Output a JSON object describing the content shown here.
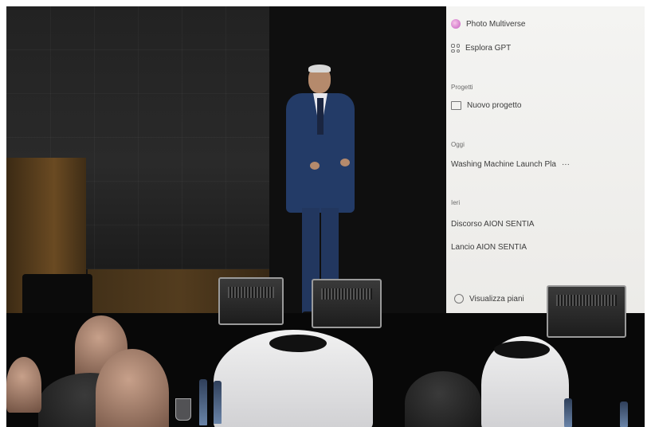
{
  "screen_menu": {
    "photo_label": "Photo Multiverse",
    "explore_label": "Esplora GPT",
    "projects_heading": "Progetti",
    "new_project_label": "Nuovo progetto",
    "today_heading": "Oggi",
    "today_item": "Washing Machine Launch Pla",
    "today_more": "···",
    "yesterday_heading": "Ieri",
    "yesterday_items": [
      "Discorso AION SENTIA",
      "Lancio AION SENTIA"
    ],
    "plans_label": "Visualizza piani"
  },
  "colors": {
    "suit": "#233b67",
    "screen_bg": "#f4f4f2",
    "stage": "#080808"
  },
  "icons": [
    "photo-multiverse-icon",
    "grid-icon",
    "folder-icon",
    "plans-icon"
  ]
}
